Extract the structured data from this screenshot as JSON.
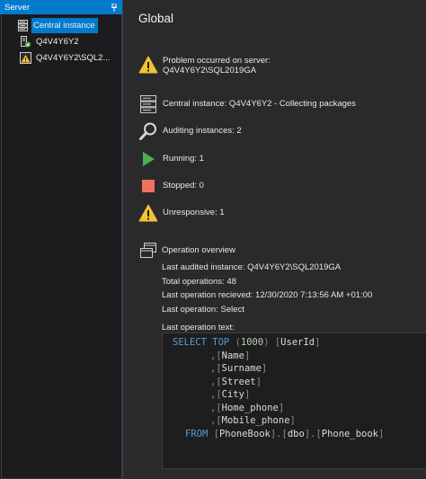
{
  "panel": {
    "title": "Server",
    "items": [
      {
        "label": "Central instance",
        "icon": "server-icon",
        "selected": true
      },
      {
        "label": "Q4V4Y6Y2",
        "icon": "agent-ok-icon",
        "selected": false
      },
      {
        "label": "Q4V4Y6Y2\\SQL2...",
        "icon": "sql-warning-icon",
        "selected": false
      }
    ]
  },
  "main": {
    "title": "Global",
    "problem": {
      "line1": "Problem occurred on server:",
      "line2": "Q4V4Y6Y2\\SQL2019GA",
      "icon": "warning-icon"
    },
    "central": {
      "label": "Central instance: Q4V4Y6Y2 - Collecting packages",
      "icon": "server-icon"
    },
    "auditing": {
      "label": "Auditing instances: 2",
      "icon": "magnifier-icon"
    },
    "running": {
      "label": "Running: 1",
      "icon": "play-icon"
    },
    "stopped": {
      "label": "Stopped: 0",
      "icon": "stop-icon"
    },
    "unresponsive": {
      "label": "Unresponsive: 1",
      "icon": "warning-icon"
    },
    "overview": {
      "title": "Operation overview",
      "icon": "windows-icon",
      "last_audited": "Last audited instance:  Q4V4Y6Y2\\SQL2019GA",
      "total_ops": "Total operations:  48",
      "last_received": "Last operation recieved:  12/30/2020 7:13:56 AM +01:00",
      "last_operation": "Last operation:  Select",
      "last_text_label": "Last operation text:"
    },
    "sql": {
      "select": "SELECT",
      "top": "TOP",
      "top_num": "1000",
      "columns": [
        "UserId",
        "Name",
        "Surname",
        "Street",
        "City",
        "Home_phone",
        "Mobile_phone"
      ],
      "from": "FROM",
      "table_db": "PhoneBook",
      "table_schema": "dbo",
      "table_name": "Phone_book"
    }
  },
  "colors": {
    "accent": "#007acc",
    "warning": "#f2c230",
    "running": "#4caf50",
    "stopped": "#f07060",
    "sql_keyword": "#569cd6",
    "sql_number": "#b5cea8"
  }
}
